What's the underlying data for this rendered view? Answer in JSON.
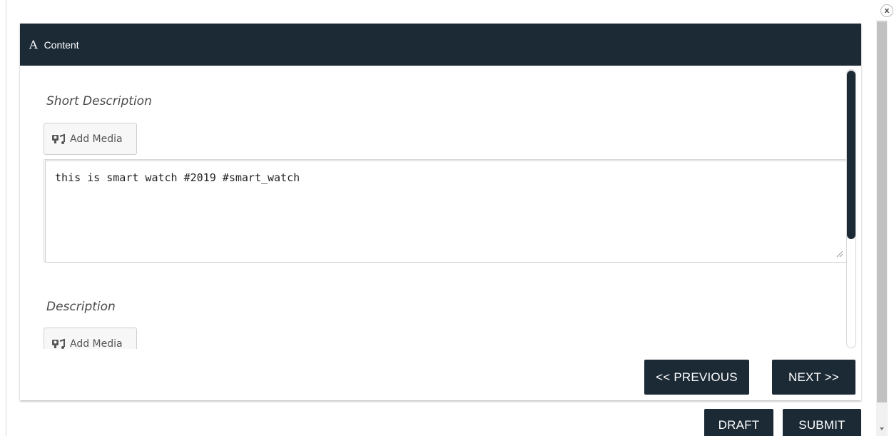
{
  "dialog": {
    "close_label": "x"
  },
  "panel": {
    "header_icon": "A",
    "title": "Content"
  },
  "short_description": {
    "label": "Short Description",
    "add_media_label": "Add Media",
    "value": "this is smart watch #2019 #smart_watch"
  },
  "description": {
    "label": "Description",
    "add_media_label": "Add Media"
  },
  "nav": {
    "previous_label": "<< PREVIOUS",
    "next_label": "NEXT >>"
  },
  "actions": {
    "draft_label": "DRAFT",
    "submit_label": "SUBMIT"
  },
  "colors": {
    "header_bg": "#1c2a36",
    "button_bg": "#1c2a36"
  },
  "icons": {
    "add_media": "media-icon",
    "close": "close-icon",
    "header": "text-icon"
  }
}
